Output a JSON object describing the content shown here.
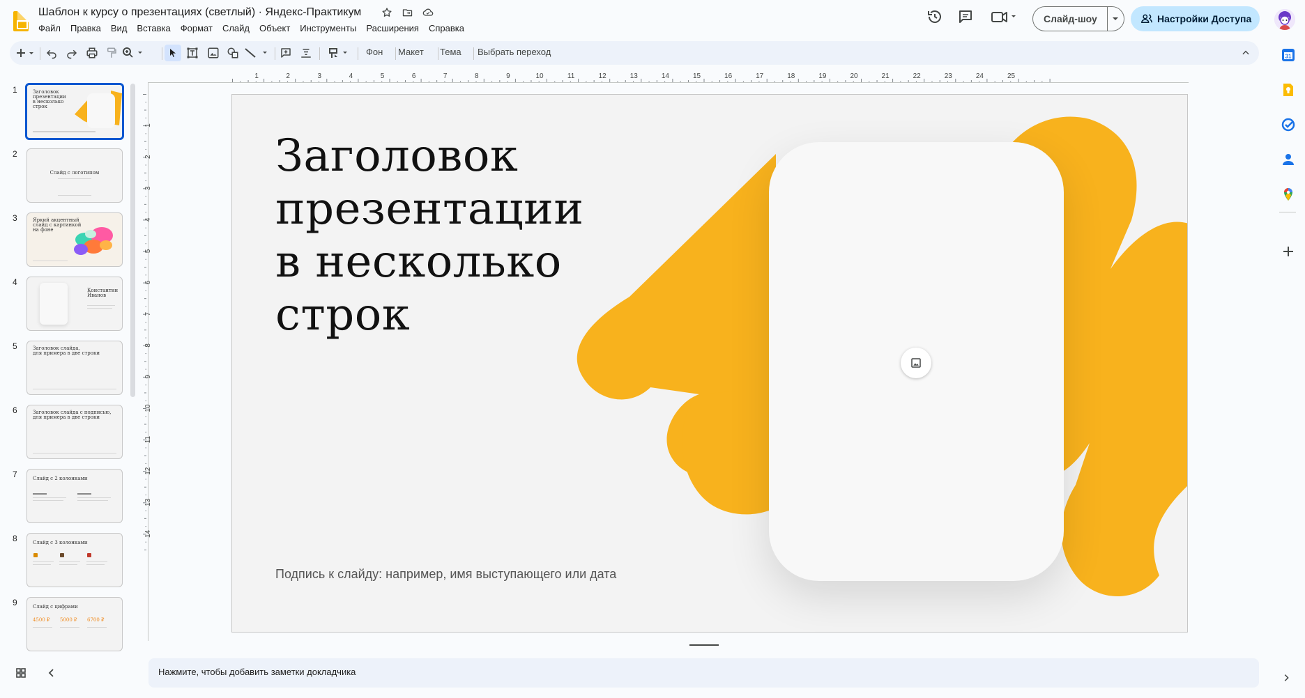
{
  "app": {
    "doc_title": "Шаблон к курсу о презентациях (светлый) · Яндекс-Практикум"
  },
  "menu": [
    "Файл",
    "Правка",
    "Вид",
    "Вставка",
    "Формат",
    "Слайд",
    "Объект",
    "Инструменты",
    "Расширения",
    "Справка"
  ],
  "header": {
    "slideshow_label": "Слайд-шоу",
    "share_label": "Настройки Доступа"
  },
  "toolbar": {
    "background_label": "Фон",
    "layout_label": "Макет",
    "theme_label": "Тема",
    "transition_label": "Выбрать переход"
  },
  "ruler": {
    "top_ticks": [
      "1",
      "2",
      "3",
      "4",
      "5",
      "6",
      "7",
      "8",
      "9",
      "10",
      "11",
      "12",
      "13",
      "14",
      "15",
      "16",
      "17",
      "18",
      "19",
      "20",
      "21",
      "22",
      "23",
      "24",
      "25"
    ],
    "left_ticks": [
      "1",
      "2",
      "3",
      "4",
      "5",
      "6",
      "7",
      "8",
      "9",
      "10",
      "11",
      "12",
      "13",
      "14"
    ]
  },
  "slides": [
    {
      "num": "1",
      "title": "Заголовок\nпрезентации\nв несколько\nстрок"
    },
    {
      "num": "2",
      "title": "Слайд с логотипом"
    },
    {
      "num": "3",
      "title": "Яркий акцентный\nслайд с картинкой\nна фоне"
    },
    {
      "num": "4",
      "title": "Константин\nИванов"
    },
    {
      "num": "5",
      "title": "Заголовок слайда,\nдля примера в две строки"
    },
    {
      "num": "6",
      "title": "Заголовок слайда с подписью,\nдля примера в две строки"
    },
    {
      "num": "7",
      "title": "Слайд с 2 колонками"
    },
    {
      "num": "8",
      "title": "Слайд с 3 колонками"
    },
    {
      "num": "9",
      "title": "Слайд с цифрами",
      "numbers": [
        "4500 ₽",
        "5000 ₽",
        "6700 ₽"
      ]
    }
  ],
  "slide": {
    "title": "Заголовок\nпрезентации\nв несколько\nстрок",
    "subtitle": "Подпись к слайду: например, имя выступающего или дата"
  },
  "notes": {
    "placeholder": "Нажмите, чтобы добавить заметки докладчика"
  },
  "colors": {
    "accent_yellow": "#f8b21d",
    "share_bg": "#c2e7ff",
    "selection_blue": "#0b57d0"
  },
  "side_panel_icons": [
    "calendar-icon",
    "keep-icon",
    "tasks-icon",
    "contacts-icon",
    "maps-icon",
    "add-icon"
  ]
}
